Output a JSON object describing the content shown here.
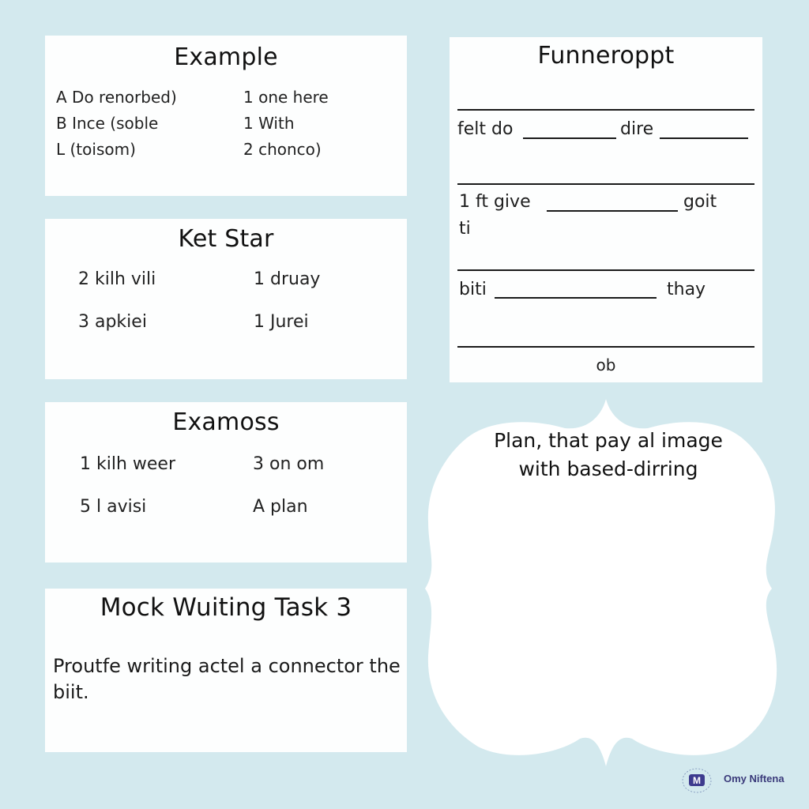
{
  "cards": {
    "example": {
      "title": "Example",
      "left": [
        "A Do renorbed)",
        "B Ince (soble",
        "L (toisom)"
      ],
      "right": [
        "1 one here",
        "1 With",
        "2 chonco)"
      ]
    },
    "ket_star": {
      "title": "Ket Star",
      "left": [
        "2 kilh vili",
        "3 apkiei"
      ],
      "right": [
        "1 druay",
        "1 Jurei"
      ]
    },
    "examoss": {
      "title": "Examoss",
      "left": [
        "1 kilh weer",
        "5 l avisi"
      ],
      "right": [
        "3 on om",
        "A plan"
      ]
    },
    "mock_task": {
      "title": "Mock Wuiting Task 3",
      "body": "Proutfe writing actel a connector the biit."
    }
  },
  "form": {
    "title": "Funneroppt",
    "line1": {
      "left": "felt do",
      "mid": "dire"
    },
    "line2": {
      "left": "1 ft give",
      "right": "goit",
      "cont": "ti"
    },
    "line3": {
      "left": "biti",
      "right": "thay"
    },
    "footer": "ob"
  },
  "cloud": {
    "text_line1": "Plan, that pay al image",
    "text_line2": "with based-dirring"
  },
  "brand": {
    "name": "Omy Niftena",
    "logo_letter": "M",
    "logo_color": "#3d3b8e"
  },
  "colors": {
    "background": "#d3e9ee",
    "card": "#fdfefe",
    "text": "#151515"
  }
}
